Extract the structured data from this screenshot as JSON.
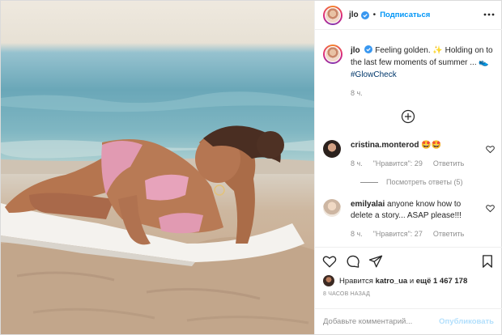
{
  "post": {
    "image_alt": "Woman lying on a white towel on a sandy beach by the sea"
  },
  "header": {
    "username": "jlo",
    "follow_label": "Подписаться",
    "separator": "•"
  },
  "caption": {
    "username": "jlo",
    "text": "Feeling golden. ✨ Holding on to the last few moments of summer ... 👟",
    "hashtag": "#GlowCheck",
    "time": "8 ч."
  },
  "comments": [
    {
      "username": "cristina.monterod",
      "text": "🤩🤩",
      "time": "8 ч.",
      "likes": "\"Нравится\": 29",
      "reply_label": "Ответить"
    },
    {
      "username": "emilyalai",
      "text": "anyone know how to delete a story... ASAP please!!!",
      "time": "8 ч.",
      "likes": "\"Нравится\": 27",
      "reply_label": "Ответить"
    }
  ],
  "replies": {
    "label": "Посмотреть ответы (5)"
  },
  "likes": {
    "prefix": "Нравится",
    "user": "katro_ua",
    "middle": "и",
    "count": "ещё 1 467 178"
  },
  "posted": "8 ЧАСОВ НАЗАД",
  "add_comment": {
    "placeholder": "Добавьте комментарий...",
    "publish_label": "Опубликовать"
  },
  "colors": {
    "link_blue": "#0095f6",
    "publish_disabled": "#b2dffc",
    "meta_gray": "#8e8e8e",
    "hashtag": "#00376b"
  },
  "icons": [
    "verified-badge-icon",
    "more-options-icon",
    "add-circle-icon",
    "heart-icon",
    "comment-icon",
    "share-icon",
    "bookmark-icon"
  ]
}
